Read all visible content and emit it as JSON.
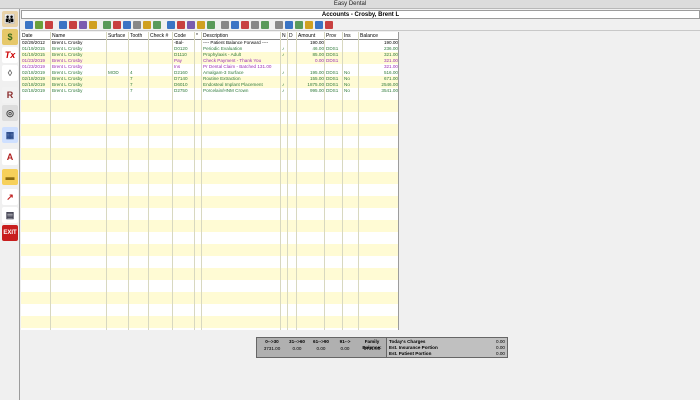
{
  "window": {
    "title": "Easy Dental"
  },
  "header": {
    "title": "Accounts - Crosby, Brent L"
  },
  "columns": [
    "Date",
    "Name",
    "Surface",
    "Tooth",
    "Check #",
    "Code",
    "*",
    "Description",
    "N",
    "D",
    "Amount",
    "Prov",
    "Ins",
    "Balance"
  ],
  "rows": [
    {
      "date": "02/29/2012",
      "name": "Brent L Crosby",
      "surface": "",
      "tooth": "",
      "check": "",
      "code": "-Bal-",
      "star": "",
      "desc": "---- Patient Balance Forward ----",
      "n": "",
      "d": "",
      "amount": "190.00",
      "prov": "",
      "ins": "",
      "balance": "190.00",
      "color": "black"
    },
    {
      "date": "01/19/2015",
      "name": "Brent L Crosby",
      "surface": "",
      "tooth": "",
      "check": "",
      "code": "D0120",
      "star": "",
      "desc": "Periodic Evaluation",
      "n": "♪",
      "d": "",
      "amount": "46.00",
      "prov": "DDS1",
      "ins": "",
      "balance": "236.00",
      "color": "green"
    },
    {
      "date": "01/19/2015",
      "name": "Brent L Crosby",
      "surface": "",
      "tooth": "",
      "check": "",
      "code": "D1110",
      "star": "",
      "desc": "Prophylaxis - Adult",
      "n": "♪",
      "d": "",
      "amount": "85.00",
      "prov": "DDS1",
      "ins": "",
      "balance": "321.00",
      "color": "green"
    },
    {
      "date": "01/23/2019",
      "name": "Brent L Crosby",
      "surface": "",
      "tooth": "",
      "check": "",
      "code": "Pay",
      "star": "",
      "desc": "Check Payment - Thank You",
      "n": "",
      "d": "",
      "amount": "0.00",
      "prov": "DDS1",
      "ins": "",
      "balance": "321.00",
      "color": "purple"
    },
    {
      "date": "01/23/2019",
      "name": "Brent L Crosby",
      "surface": "",
      "tooth": "",
      "check": "",
      "code": "Ins",
      "star": "",
      "desc": "Pr Dental Claim - Batched 131.00",
      "n": "",
      "d": "",
      "amount": "",
      "prov": "",
      "ins": "",
      "balance": "321.00",
      "color": "purple"
    },
    {
      "date": "02/18/2019",
      "name": "Brent L Crosby",
      "surface": "MOD",
      "tooth": "4",
      "check": "",
      "code": "D2160",
      "star": "",
      "desc": "Amalgam-3 Surface",
      "n": "♪",
      "d": "",
      "amount": "195.00",
      "prov": "DDS1",
      "ins": "No",
      "balance": "516.00",
      "color": "green"
    },
    {
      "date": "02/18/2019",
      "name": "Brent L Crosby",
      "surface": "",
      "tooth": "7",
      "check": "",
      "code": "D7140",
      "star": "",
      "desc": "Routine Extraction",
      "n": "",
      "d": "",
      "amount": "155.00",
      "prov": "DDS1",
      "ins": "No",
      "balance": "671.00",
      "color": "green"
    },
    {
      "date": "02/18/2019",
      "name": "Brent L Crosby",
      "surface": "",
      "tooth": "7",
      "check": "",
      "code": "D6010",
      "star": "",
      "desc": "Endosteal Implant Placement",
      "n": "♪",
      "d": "",
      "amount": "1875.00",
      "prov": "DDS1",
      "ins": "No",
      "balance": "2546.00",
      "color": "green"
    },
    {
      "date": "02/18/2019",
      "name": "Brent L Crosby",
      "surface": "",
      "tooth": "7",
      "check": "",
      "code": "D2750",
      "star": "",
      "desc": "Porcelain/HNM Crown",
      "n": "♪",
      "d": "",
      "amount": "995.00",
      "prov": "DDS1",
      "ins": "No",
      "balance": "3541.00",
      "color": "green"
    }
  ],
  "aging": {
    "headers": [
      "0-->30",
      "31-->60",
      "61-->90",
      "91-->",
      "Family Balance:"
    ],
    "values": [
      "3731.00",
      "0.00",
      "0.00",
      "0.00",
      "3731.00"
    ]
  },
  "summary": [
    {
      "label": "Today's Charges",
      "value": "0.00"
    },
    {
      "label": "Est. Insurance Portion",
      "value": "0.00"
    },
    {
      "label": "Est. Patient Portion",
      "value": "0.00"
    }
  ],
  "colors": {
    "green": "#2f7a3a",
    "purple": "#9a2fb4",
    "stripe": "#fffbd4"
  },
  "icons": [
    "family-icon",
    "money-icon",
    "tx-icon",
    "tooth-icon",
    "rx-icon",
    "xray-icon",
    "chart-icon",
    "letter-icon",
    "folder-icon",
    "report-icon",
    "pad-icon",
    "exit-icon"
  ]
}
